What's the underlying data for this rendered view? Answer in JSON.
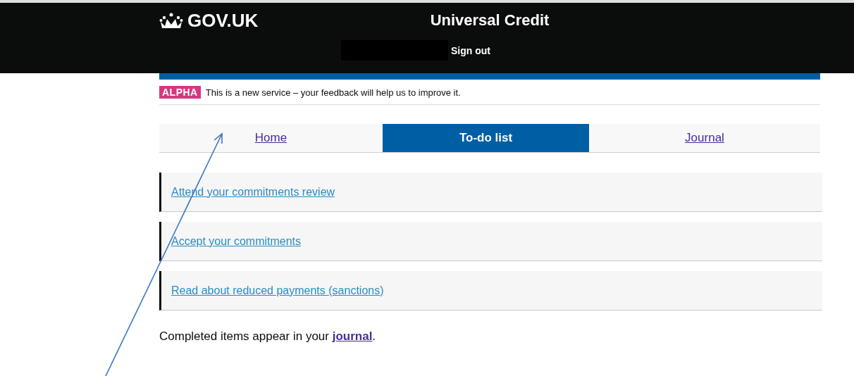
{
  "header": {
    "logo": "GOV.UK",
    "service_name": "Universal Credit",
    "sign_out": "Sign out"
  },
  "phase_banner": {
    "tag": "ALPHA",
    "message": "This is a new service – your feedback will help us to improve it."
  },
  "tabs": [
    {
      "label": "Home",
      "selected": false
    },
    {
      "label": "To-do list",
      "selected": true
    },
    {
      "label": "Journal",
      "selected": false
    }
  ],
  "tasks": [
    {
      "label": "Attend your commitments review"
    },
    {
      "label": "Accept your commitments"
    },
    {
      "label": "Read about reduced payments (sanctions)"
    }
  ],
  "note": {
    "before": "Completed items appear in your ",
    "link": "journal",
    "after": "."
  }
}
